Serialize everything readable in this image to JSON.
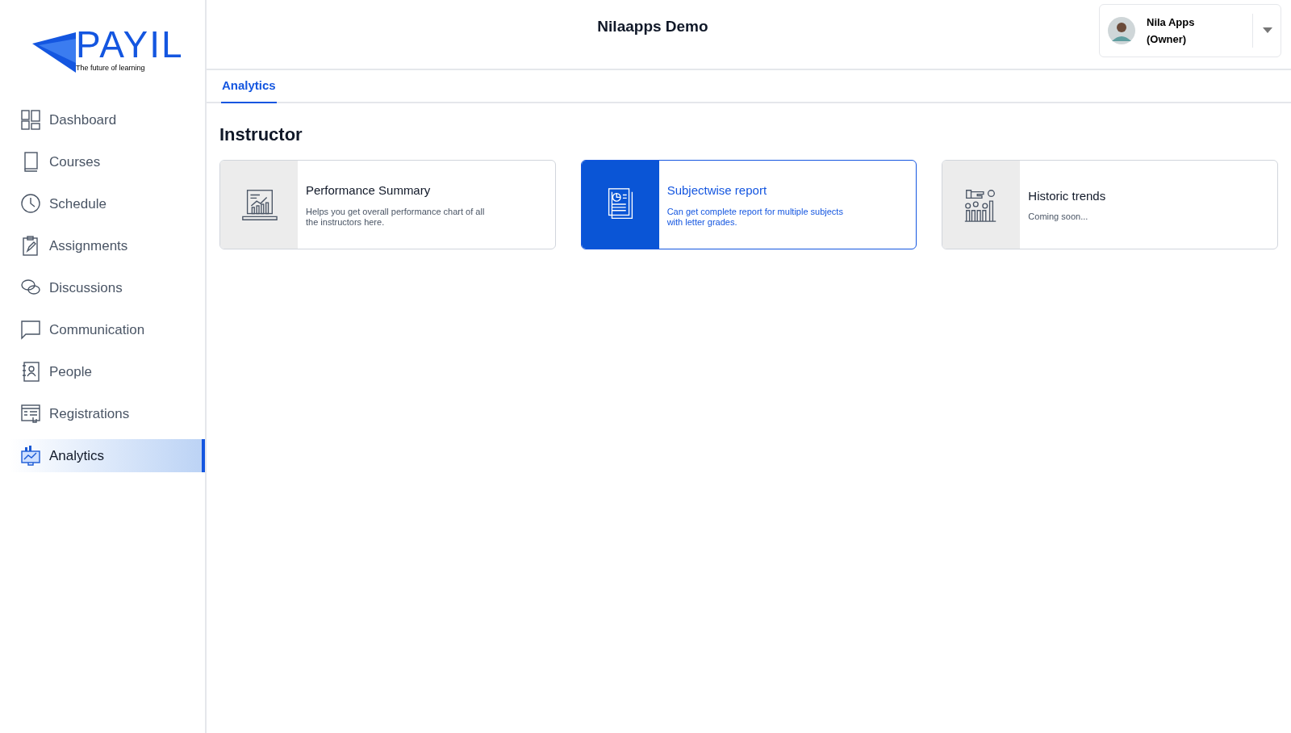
{
  "logo": {
    "name": "PAYIL",
    "tagline": "The future of learning"
  },
  "sidebar": {
    "items": [
      {
        "kind": "dashboard",
        "label": "Dashboard",
        "selected": false
      },
      {
        "kind": "courses",
        "label": "Courses",
        "selected": false
      },
      {
        "kind": "schedule",
        "label": "Schedule",
        "selected": false
      },
      {
        "kind": "assignments",
        "label": "Assignments",
        "selected": false
      },
      {
        "kind": "discussions",
        "label": "Discussions",
        "selected": false
      },
      {
        "kind": "communication",
        "label": "Communication",
        "selected": false
      },
      {
        "kind": "people",
        "label": "People",
        "selected": false
      },
      {
        "kind": "registrations",
        "label": "Registrations",
        "selected": false
      },
      {
        "kind": "analytics",
        "label": "Analytics",
        "selected": true
      }
    ]
  },
  "header": {
    "title": "Nilaapps Demo",
    "user": {
      "name": "Nila Apps",
      "role": "(Owner)"
    }
  },
  "tabs": [
    {
      "label": "Analytics",
      "selected": true
    }
  ],
  "section": {
    "title": "Instructor",
    "cards": [
      {
        "kind": "performance",
        "title": "Performance Summary",
        "description": "Helps you get overall performance chart of all the instructors here.",
        "selected": false
      },
      {
        "kind": "subject",
        "title": "Subjectwise report",
        "description": "Can get complete report for multiple subjects with letter grades.",
        "selected": true
      },
      {
        "kind": "trends",
        "title": "Historic trends",
        "description": "Coming soon...",
        "selected": false
      }
    ]
  }
}
